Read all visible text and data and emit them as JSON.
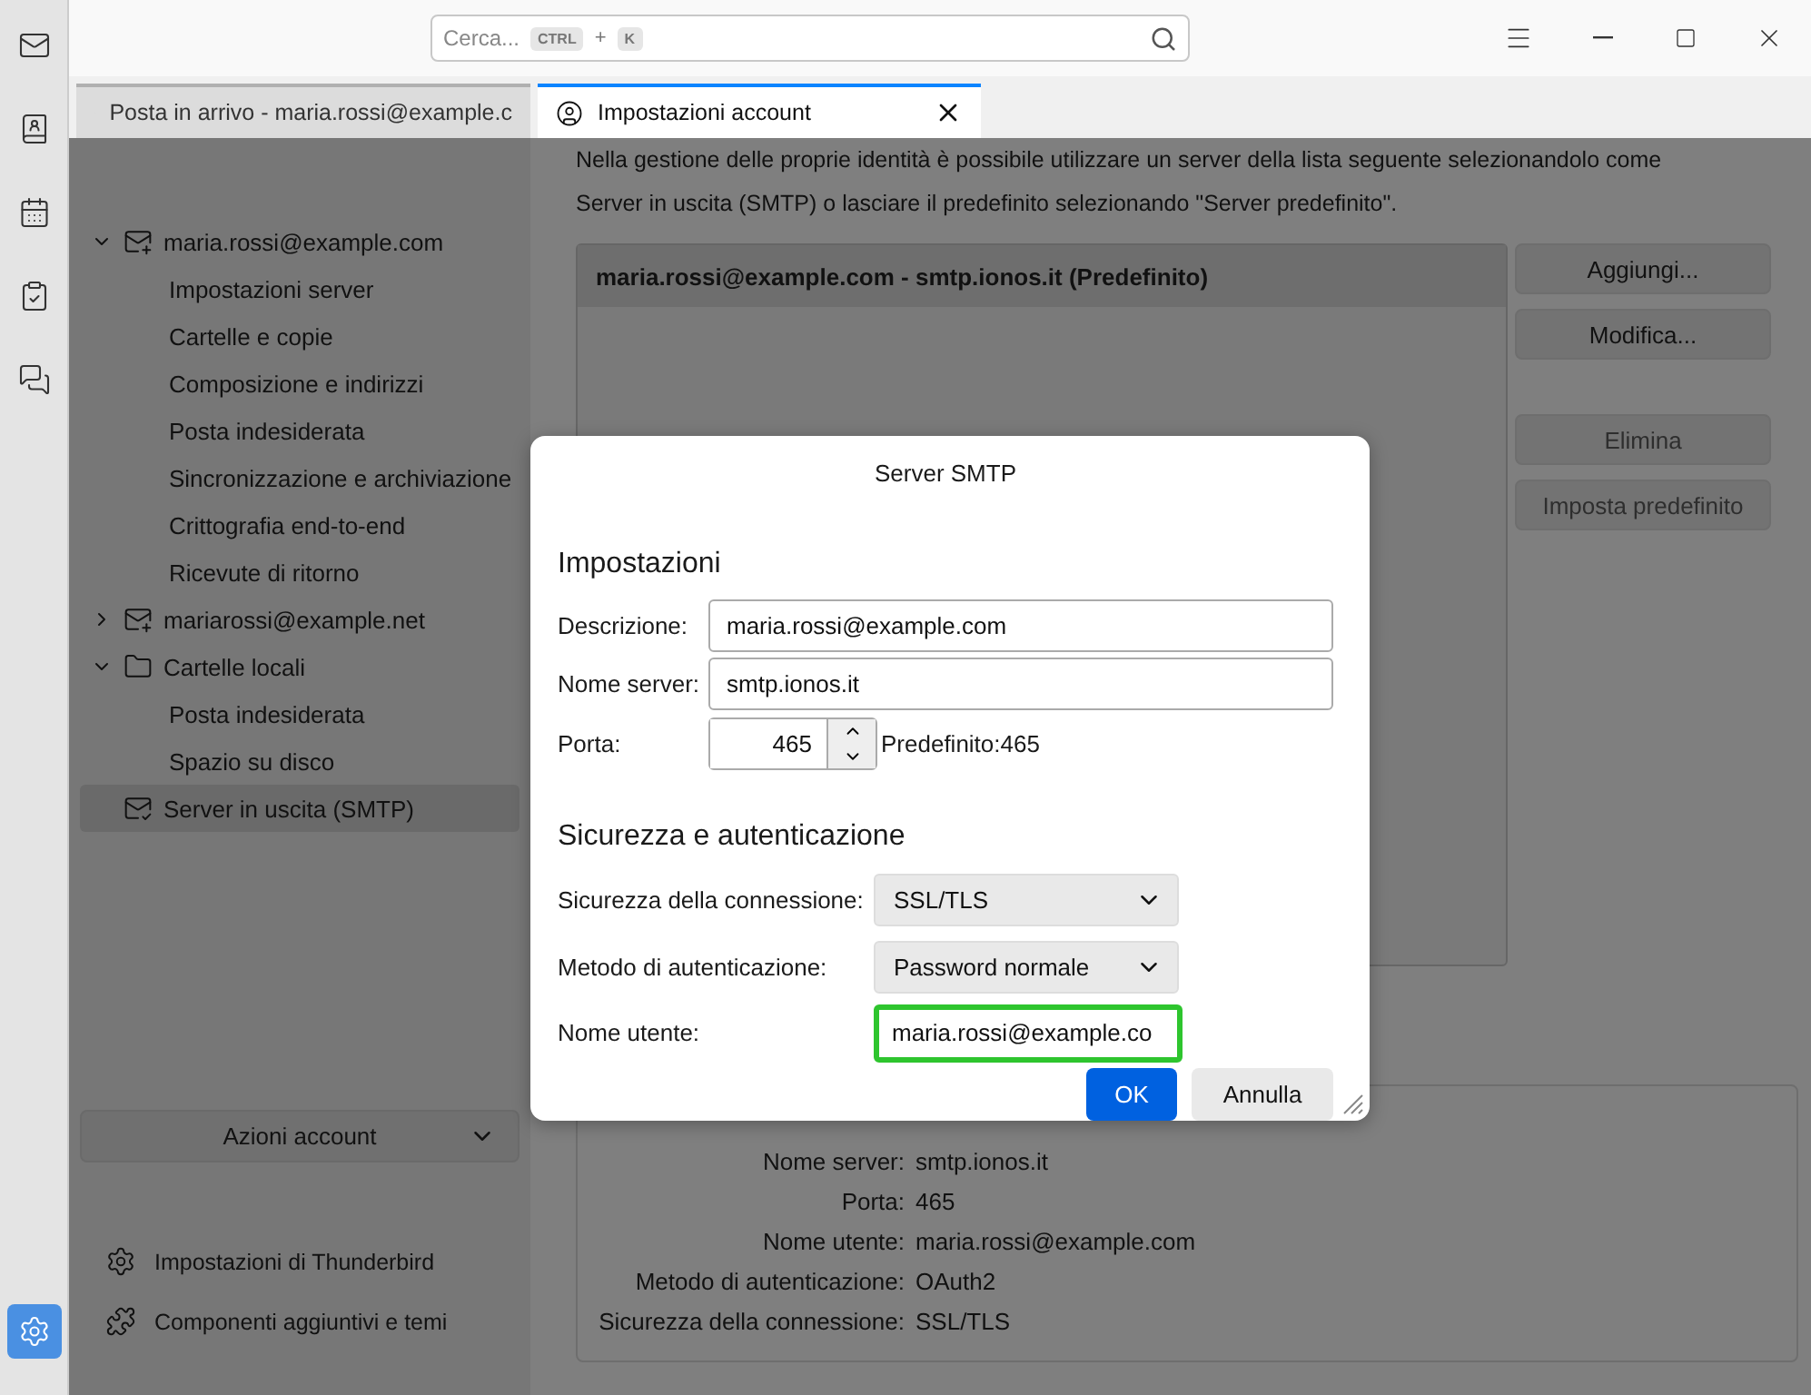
{
  "search": {
    "placeholder": "Cerca...",
    "keys": [
      "CTRL",
      "+",
      "K"
    ]
  },
  "rail": [
    {
      "kind": "mail",
      "selected": false
    },
    {
      "kind": "contacts",
      "selected": false
    },
    {
      "kind": "calendar",
      "selected": false
    },
    {
      "kind": "tasks",
      "selected": false
    },
    {
      "kind": "chat",
      "selected": false
    }
  ],
  "rail_bottom": {
    "kind": "settings",
    "selected": true
  },
  "tabs": [
    {
      "kind": "inbox",
      "label": "Posta in arrivo - maria.rossi@example.c",
      "selected": false,
      "closable": false
    },
    {
      "kind": "account",
      "label": "Impostazioni account",
      "selected": true,
      "closable": true
    }
  ],
  "sidebar": {
    "tree": [
      {
        "kind": "account",
        "label": "maria.rossi@example.com",
        "expanded": true,
        "selected": false,
        "children": [
          {
            "label": "Impostazioni server",
            "selected": false
          },
          {
            "label": "Cartelle e copie",
            "selected": false
          },
          {
            "label": "Composizione e indirizzi",
            "selected": false
          },
          {
            "label": "Posta indesiderata",
            "selected": false
          },
          {
            "label": "Sincronizzazione e archiviazione",
            "selected": false
          },
          {
            "label": "Crittografia end-to-end",
            "selected": false
          },
          {
            "label": "Ricevute di ritorno",
            "selected": false
          }
        ]
      },
      {
        "kind": "account",
        "label": "mariarossi@example.net",
        "expanded": false,
        "selected": false
      },
      {
        "kind": "folder",
        "label": "Cartelle locali",
        "expanded": true,
        "selected": false,
        "children": [
          {
            "label": "Posta indesiderata",
            "selected": false
          },
          {
            "label": "Spazio su disco",
            "selected": false
          }
        ]
      },
      {
        "kind": "outgoing",
        "label": "Server in uscita (SMTP)",
        "selected": true
      }
    ],
    "actions_button": "Azioni account",
    "footer_links": [
      {
        "kind": "settings",
        "label": "Impostazioni di Thunderbird"
      },
      {
        "kind": "addons",
        "label": "Componenti aggiuntivi e temi"
      }
    ]
  },
  "content": {
    "intro": [
      "Nella gestione delle proprie identità è possibile utilizzare un server della lista seguente selezionandolo come",
      "Server in uscita (SMTP) o lasciare il predefinito selezionando \"Server predefinito\"."
    ],
    "servers": [
      {
        "label": "maria.rossi@example.com - smtp.ionos.it (Predefinito)",
        "selected": true
      }
    ],
    "buttons": [
      {
        "label": "Aggiungi...",
        "disabled": false
      },
      {
        "label": "Modifica...",
        "disabled": false
      },
      {
        "label": "Elimina",
        "disabled": true
      },
      {
        "label": "Imposta predefinito",
        "disabled": true
      }
    ],
    "details": [
      {
        "label": "Nome server:",
        "value": "smtp.ionos.it"
      },
      {
        "label": "Porta:",
        "value": "465"
      },
      {
        "label": "Nome utente:",
        "value": "maria.rossi@example.com"
      },
      {
        "label": "Metodo di autenticazione:",
        "value": "OAuth2"
      },
      {
        "label": "Sicurezza della connessione:",
        "value": "SSL/TLS"
      }
    ]
  },
  "dialog": {
    "title": "Server SMTP",
    "settings_heading": "Impostazioni",
    "description": {
      "label": "Descrizione:",
      "value": "maria.rossi@example.com"
    },
    "server_name": {
      "label": "Nome server:",
      "value": "smtp.ionos.it"
    },
    "port": {
      "label": "Porta:",
      "value": "465",
      "default_note": "Predefinito:465"
    },
    "security_heading": "Sicurezza e autenticazione",
    "connection_security": {
      "label": "Sicurezza della connessione:",
      "value": "SSL/TLS"
    },
    "auth_method": {
      "label": "Metodo di autenticazione:",
      "value": "Password normale"
    },
    "username": {
      "label": "Nome utente:",
      "value": "maria.rossi@example.co",
      "focused": true
    },
    "ok": "OK",
    "cancel": "Annulla"
  }
}
